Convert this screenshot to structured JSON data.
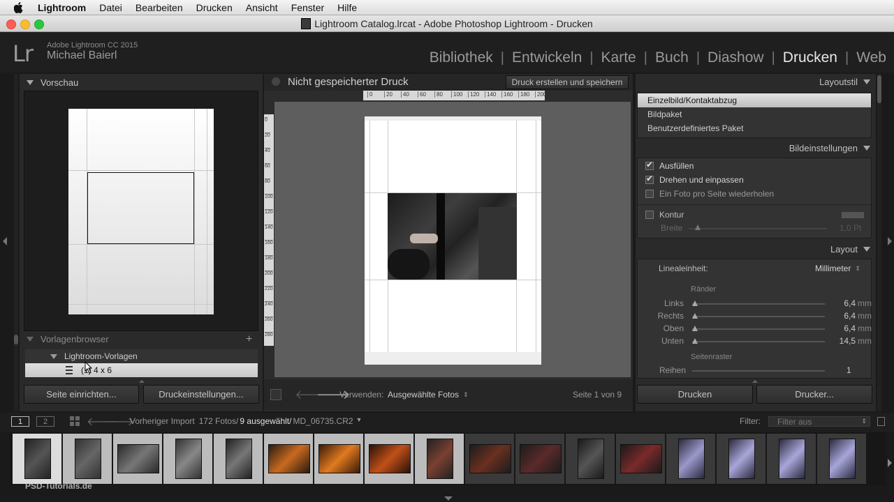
{
  "menubar": {
    "app": "Lightroom",
    "items": [
      "Datei",
      "Bearbeiten",
      "Drucken",
      "Ansicht",
      "Fenster",
      "Hilfe"
    ]
  },
  "window": {
    "title": "Lightroom Catalog.lrcat - Adobe Photoshop Lightroom - Drucken"
  },
  "identity": {
    "logo": "Lr",
    "product": "Adobe Lightroom CC 2015",
    "user": "Michael Baierl"
  },
  "modules": [
    {
      "label": "Bibliothek",
      "active": false
    },
    {
      "label": "Entwickeln",
      "active": false
    },
    {
      "label": "Karte",
      "active": false
    },
    {
      "label": "Buch",
      "active": false
    },
    {
      "label": "Diashow",
      "active": false
    },
    {
      "label": "Drucken",
      "active": true
    },
    {
      "label": "Web",
      "active": false
    }
  ],
  "left": {
    "preview_title": "Vorschau",
    "template_browser_title": "Vorlagenbrowser",
    "template_folder": "Lightroom-Vorlagen",
    "template_item": "(1) 4 x 6",
    "page_setup_button": "Seite einrichten...",
    "print_settings_button": "Druckeinstellungen..."
  },
  "center": {
    "title": "Nicht gespeicherter Druck",
    "create_saved_button": "Druck erstellen und speichern",
    "ruler_top": [
      "0",
      "20",
      "40",
      "60",
      "80",
      "100",
      "120",
      "140",
      "160",
      "180",
      "200"
    ],
    "ruler_left": [
      "0",
      "20",
      "40",
      "60",
      "80",
      "100",
      "120",
      "140",
      "160",
      "180",
      "200",
      "220",
      "240",
      "260",
      "280"
    ],
    "use_label": "Verwenden:",
    "use_value": "Ausgewählte Fotos",
    "page_info": "Seite 1 von 9"
  },
  "right": {
    "layout_style_title": "Layoutstil",
    "layout_styles": [
      {
        "label": "Einzelbild/Kontaktabzug",
        "selected": true
      },
      {
        "label": "Bildpaket",
        "selected": false
      },
      {
        "label": "Benutzerdefiniertes Paket",
        "selected": false
      }
    ],
    "image_settings_title": "Bildeinstellungen",
    "image_settings": [
      {
        "label": "Ausfüllen",
        "checked": true
      },
      {
        "label": "Drehen und einpassen",
        "checked": true
      },
      {
        "label": "Ein Foto pro Seite wiederholen",
        "checked": false
      }
    ],
    "stroke_label": "Kontur",
    "stroke_checked": false,
    "stroke_width_label": "Breite",
    "stroke_width_value": "1,0 Pt",
    "layout_title": "Layout",
    "ruler_units_label": "Linealeinheit:",
    "ruler_units_value": "Millimeter",
    "margins_title": "Ränder",
    "margins": [
      {
        "label": "Links",
        "value": "6,4",
        "unit": "mm",
        "level": 0.02
      },
      {
        "label": "Rechts",
        "value": "6,4",
        "unit": "mm",
        "level": 0.02
      },
      {
        "label": "Oben",
        "value": "6,4",
        "unit": "mm",
        "level": 0.02
      },
      {
        "label": "Unten",
        "value": "14,5",
        "unit": "mm",
        "level": 0.02
      }
    ],
    "page_grid_title": "Seitenraster",
    "rows_label": "Reihen",
    "rows_value": "1",
    "print_button": "Drucken",
    "printer_button": "Drucker..."
  },
  "filmstrip_bar": {
    "view1": "1",
    "view2": "2",
    "source": "Vorheriger Import",
    "count": "172 Fotos/",
    "selected": "9 ausgewählt/",
    "file": "MD_06735.CR2",
    "filter_label": "Filter:",
    "filter_value": "Filter aus"
  },
  "watermark": "PSD-Tutorials.de",
  "colors": {
    "accent_active": "#e8e8e8",
    "panel": "#2a2a2a",
    "canvas": "#5e5e5e"
  }
}
